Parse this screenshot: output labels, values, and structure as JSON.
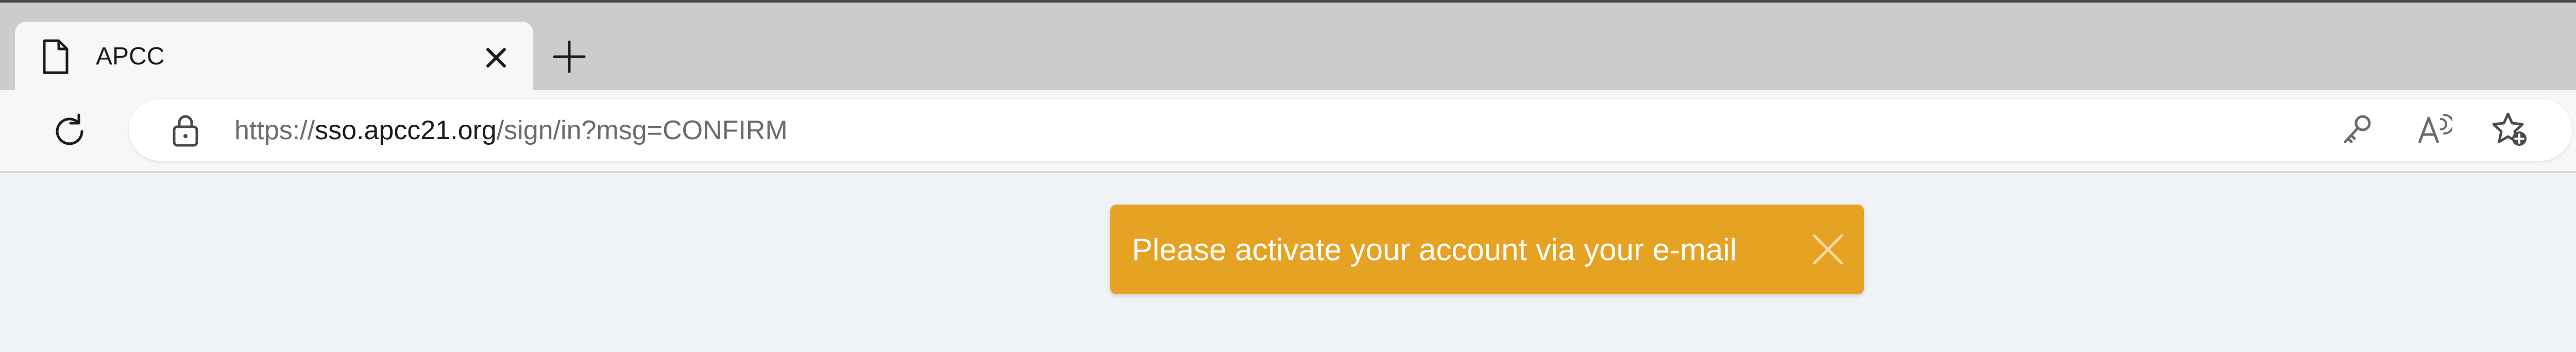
{
  "browser": {
    "tabs": [
      {
        "title": "APCC",
        "icon": "page-icon",
        "active": true
      }
    ],
    "address": {
      "scheme": "https://",
      "host": "sso.apcc21.org",
      "path": "/sign/in?msg=CONFIRM"
    },
    "toolbar_icons": [
      "reload-icon",
      "lock-icon",
      "key-icon",
      "read-aloud-icon",
      "add-favorite-icon"
    ]
  },
  "page": {
    "background": "#f0f3f6",
    "toast": {
      "message": "Please activate your account via your e-mail",
      "color": "#e6a222"
    }
  }
}
